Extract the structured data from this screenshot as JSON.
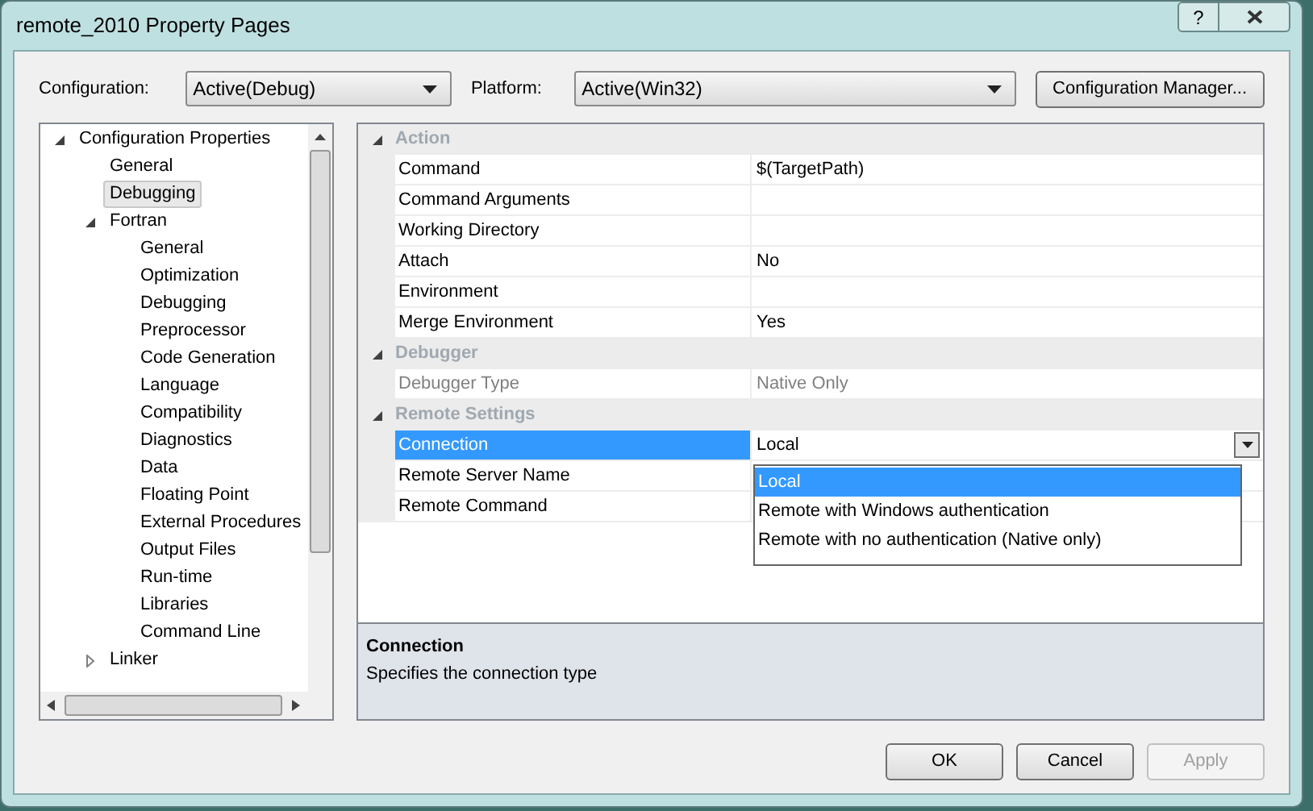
{
  "window": {
    "title": "remote_2010 Property Pages",
    "help_button": "?"
  },
  "configuration": {
    "label": "Configuration:",
    "value": "Active(Debug)"
  },
  "platform": {
    "label": "Platform:",
    "value": "Active(Win32)"
  },
  "configuration_manager_button": "Configuration Manager...",
  "tree": [
    {
      "label": "Configuration Properties",
      "expanded": true,
      "selected": false,
      "children": [
        {
          "label": "General",
          "selected": false
        },
        {
          "label": "Debugging",
          "selected": true
        },
        {
          "label": "Fortran",
          "expanded": true,
          "selected": false,
          "children": [
            {
              "label": "General",
              "selected": false
            },
            {
              "label": "Optimization",
              "selected": false
            },
            {
              "label": "Debugging",
              "selected": false
            },
            {
              "label": "Preprocessor",
              "selected": false
            },
            {
              "label": "Code Generation",
              "selected": false
            },
            {
              "label": "Language",
              "selected": false
            },
            {
              "label": "Compatibility",
              "selected": false
            },
            {
              "label": "Diagnostics",
              "selected": false
            },
            {
              "label": "Data",
              "selected": false
            },
            {
              "label": "Floating Point",
              "selected": false
            },
            {
              "label": "External Procedures",
              "selected": false
            },
            {
              "label": "Output Files",
              "selected": false
            },
            {
              "label": "Run-time",
              "selected": false
            },
            {
              "label": "Libraries",
              "selected": false
            },
            {
              "label": "Command Line",
              "selected": false
            }
          ]
        },
        {
          "label": "Linker",
          "expanded": false,
          "selected": false
        }
      ]
    }
  ],
  "property_grid": {
    "sections": [
      {
        "title": "Action",
        "expanded": true,
        "rows": [
          {
            "name": "Command",
            "value": "$(TargetPath)",
            "selected": false,
            "disabled": false
          },
          {
            "name": "Command Arguments",
            "selected": false,
            "disabled": false
          },
          {
            "name": "Working Directory",
            "selected": false,
            "disabled": false
          },
          {
            "name": "Attach",
            "value": "No",
            "selected": false,
            "disabled": false
          },
          {
            "name": "Environment",
            "selected": false,
            "disabled": false
          },
          {
            "name": "Merge Environment",
            "value": "Yes",
            "selected": false,
            "disabled": false
          }
        ]
      },
      {
        "title": "Debugger",
        "expanded": true,
        "rows": [
          {
            "name": "Debugger Type",
            "value": "Native Only",
            "selected": false,
            "disabled": true
          }
        ]
      },
      {
        "title": "Remote Settings",
        "expanded": true,
        "rows": [
          {
            "name": "Connection",
            "value": "Local",
            "selected": true,
            "disabled": false,
            "dropdown": {
              "open": true,
              "options": [
                {
                  "label": "Local",
                  "selected": true
                },
                {
                  "label": "Remote with Windows authentication",
                  "selected": false
                },
                {
                  "label": "Remote with no authentication (Native only)",
                  "selected": false
                }
              ]
            }
          },
          {
            "name": "Remote Server Name",
            "selected": false,
            "disabled": false
          },
          {
            "name": "Remote Command",
            "selected": false,
            "disabled": false
          }
        ]
      }
    ]
  },
  "description": {
    "title": "Connection",
    "text": "Specifies the connection type"
  },
  "buttons": [
    {
      "label": "OK",
      "disabled": false
    },
    {
      "label": "Cancel",
      "disabled": false
    },
    {
      "label": "Apply",
      "disabled": true
    }
  ]
}
